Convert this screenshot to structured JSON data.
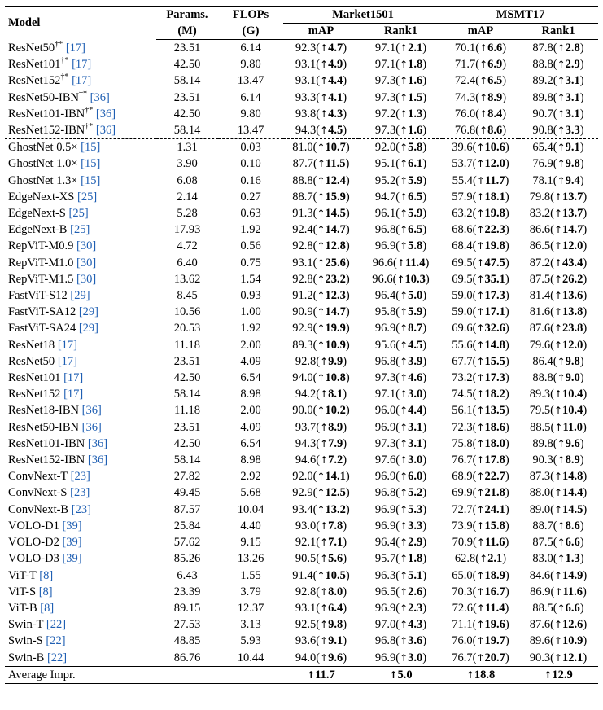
{
  "headers": {
    "model": "Model",
    "params_line1": "Params.",
    "params_line2": "(M)",
    "flops_line1": "FLOPs",
    "flops_line2": "(G)",
    "dataset1": "Market1501",
    "dataset2": "MSMT17",
    "metric_map": "mAP",
    "metric_rank1": "Rank1"
  },
  "rows": [
    {
      "name": "ResNet50",
      "mark": "†*",
      "cite": "17",
      "params": "23.51",
      "flops": "6.14",
      "m_map": "92.3",
      "m_map_d": "4.7",
      "m_r1": "97.1",
      "m_r1_d": "2.1",
      "s_map": "70.1",
      "s_map_d": "6.6",
      "s_r1": "87.8",
      "s_r1_d": "2.8"
    },
    {
      "name": "ResNet101",
      "mark": "†*",
      "cite": "17",
      "params": "42.50",
      "flops": "9.80",
      "m_map": "93.1",
      "m_map_d": "4.9",
      "m_r1": "97.1",
      "m_r1_d": "1.8",
      "s_map": "71.7",
      "s_map_d": "6.9",
      "s_r1": "88.8",
      "s_r1_d": "2.9"
    },
    {
      "name": "ResNet152",
      "mark": "†*",
      "cite": "17",
      "params": "58.14",
      "flops": "13.47",
      "m_map": "93.1",
      "m_map_d": "4.4",
      "m_r1": "97.3",
      "m_r1_d": "1.6",
      "s_map": "72.4",
      "s_map_d": "6.5",
      "s_r1": "89.2",
      "s_r1_d": "3.1"
    },
    {
      "name": "ResNet50-IBN",
      "mark": "†*",
      "cite": "36",
      "params": "23.51",
      "flops": "6.14",
      "m_map": "93.3",
      "m_map_d": "4.1",
      "m_r1": "97.3",
      "m_r1_d": "1.5",
      "s_map": "74.3",
      "s_map_d": "8.9",
      "s_r1": "89.8",
      "s_r1_d": "3.1"
    },
    {
      "name": "ResNet101-IBN",
      "mark": "†*",
      "cite": "36",
      "params": "42.50",
      "flops": "9.80",
      "m_map": "93.8",
      "m_map_d": "4.3",
      "m_r1": "97.2",
      "m_r1_d": "1.3",
      "s_map": "76.0",
      "s_map_d": "8.4",
      "s_r1": "90.7",
      "s_r1_d": "3.1"
    },
    {
      "name": "ResNet152-IBN",
      "mark": "†*",
      "cite": "36",
      "params": "58.14",
      "flops": "13.47",
      "m_map": "94.3",
      "m_map_d": "4.5",
      "m_r1": "97.3",
      "m_r1_d": "1.6",
      "s_map": "76.8",
      "s_map_d": "8.6",
      "s_r1": "90.8",
      "s_r1_d": "3.3"
    },
    {
      "name": "GhostNet 0.5×",
      "mark": "",
      "cite": "15",
      "params": "1.31",
      "flops": "0.03",
      "m_map": "81.0",
      "m_map_d": "10.7",
      "m_r1": "92.0",
      "m_r1_d": "5.8",
      "s_map": "39.6",
      "s_map_d": "10.6",
      "s_r1": "65.4",
      "s_r1_d": "9.1"
    },
    {
      "name": "GhostNet 1.0×",
      "mark": "",
      "cite": "15",
      "params": "3.90",
      "flops": "0.10",
      "m_map": "87.7",
      "m_map_d": "11.5",
      "m_r1": "95.1",
      "m_r1_d": "6.1",
      "s_map": "53.7",
      "s_map_d": "12.0",
      "s_r1": "76.9",
      "s_r1_d": "9.8"
    },
    {
      "name": "GhostNet 1.3×",
      "mark": "",
      "cite": "15",
      "params": "6.08",
      "flops": "0.16",
      "m_map": "88.8",
      "m_map_d": "12.4",
      "m_r1": "95.2",
      "m_r1_d": "5.9",
      "s_map": "55.4",
      "s_map_d": "11.7",
      "s_r1": "78.1",
      "s_r1_d": "9.4"
    },
    {
      "name": "EdgeNext-XS",
      "mark": "",
      "cite": "25",
      "params": "2.14",
      "flops": "0.27",
      "m_map": "88.7",
      "m_map_d": "15.9",
      "m_r1": "94.7",
      "m_r1_d": "6.5",
      "s_map": "57.9",
      "s_map_d": "18.1",
      "s_r1": "79.8",
      "s_r1_d": "13.7"
    },
    {
      "name": "EdgeNext-S",
      "mark": "",
      "cite": "25",
      "params": "5.28",
      "flops": "0.63",
      "m_map": "91.3",
      "m_map_d": "14.5",
      "m_r1": "96.1",
      "m_r1_d": "5.9",
      "s_map": "63.2",
      "s_map_d": "19.8",
      "s_r1": "83.2",
      "s_r1_d": "13.7"
    },
    {
      "name": "EdgeNext-B",
      "mark": "",
      "cite": "25",
      "params": "17.93",
      "flops": "1.92",
      "m_map": "92.4",
      "m_map_d": "14.7",
      "m_r1": "96.8",
      "m_r1_d": "6.5",
      "s_map": "68.6",
      "s_map_d": "22.3",
      "s_r1": "86.6",
      "s_r1_d": "14.7"
    },
    {
      "name": "RepViT-M0.9",
      "mark": "",
      "cite": "30",
      "params": "4.72",
      "flops": "0.56",
      "m_map": "92.8",
      "m_map_d": "12.8",
      "m_r1": "96.9",
      "m_r1_d": "5.8",
      "s_map": "68.4",
      "s_map_d": "19.8",
      "s_r1": "86.5",
      "s_r1_d": "12.0"
    },
    {
      "name": "RepViT-M1.0",
      "mark": "",
      "cite": "30",
      "params": "6.40",
      "flops": "0.75",
      "m_map": "93.1",
      "m_map_d": "25.6",
      "m_r1": "96.6",
      "m_r1_d": "11.4",
      "s_map": "69.5",
      "s_map_d": "47.5",
      "s_r1": "87.2",
      "s_r1_d": "43.4"
    },
    {
      "name": "RepViT-M1.5",
      "mark": "",
      "cite": "30",
      "params": "13.62",
      "flops": "1.54",
      "m_map": "92.8",
      "m_map_d": "23.2",
      "m_r1": "96.6",
      "m_r1_d": "10.3",
      "s_map": "69.5",
      "s_map_d": "35.1",
      "s_r1": "87.5",
      "s_r1_d": "26.2"
    },
    {
      "name": "FastViT-S12",
      "mark": "",
      "cite": "29",
      "params": "8.45",
      "flops": "0.93",
      "m_map": "91.2",
      "m_map_d": "12.3",
      "m_r1": "96.4",
      "m_r1_d": "5.0",
      "s_map": "59.0",
      "s_map_d": "17.3",
      "s_r1": "81.4",
      "s_r1_d": "13.6"
    },
    {
      "name": "FastViT-SA12",
      "mark": "",
      "cite": "29",
      "params": "10.56",
      "flops": "1.00",
      "m_map": "90.9",
      "m_map_d": "14.7",
      "m_r1": "95.8",
      "m_r1_d": "5.9",
      "s_map": "59.0",
      "s_map_d": "17.1",
      "s_r1": "81.6",
      "s_r1_d": "13.8"
    },
    {
      "name": "FastViT-SA24",
      "mark": "",
      "cite": "29",
      "params": "20.53",
      "flops": "1.92",
      "m_map": "92.9",
      "m_map_d": "19.9",
      "m_r1": "96.9",
      "m_r1_d": "8.7",
      "s_map": "69.6",
      "s_map_d": "32.6",
      "s_r1": "87.6",
      "s_r1_d": "23.8"
    },
    {
      "name": "ResNet18",
      "mark": "",
      "cite": "17",
      "params": "11.18",
      "flops": "2.00",
      "m_map": "89.3",
      "m_map_d": "10.9",
      "m_r1": "95.6",
      "m_r1_d": "4.5",
      "s_map": "55.6",
      "s_map_d": "14.8",
      "s_r1": "79.6",
      "s_r1_d": "12.0"
    },
    {
      "name": "ResNet50",
      "mark": "",
      "cite": "17",
      "params": "23.51",
      "flops": "4.09",
      "m_map": "92.8",
      "m_map_d": "9.9",
      "m_r1": "96.8",
      "m_r1_d": "3.9",
      "s_map": "67.7",
      "s_map_d": "15.5",
      "s_r1": "86.4",
      "s_r1_d": "9.8"
    },
    {
      "name": "ResNet101",
      "mark": "",
      "cite": "17",
      "params": "42.50",
      "flops": "6.54",
      "m_map": "94.0",
      "m_map_d": "10.8",
      "m_r1": "97.3",
      "m_r1_d": "4.6",
      "s_map": "73.2",
      "s_map_d": "17.3",
      "s_r1": "88.8",
      "s_r1_d": "9.0"
    },
    {
      "name": "ResNet152",
      "mark": "",
      "cite": "17",
      "params": "58.14",
      "flops": "8.98",
      "m_map": "94.2",
      "m_map_d": "8.1",
      "m_r1": "97.1",
      "m_r1_d": "3.0",
      "s_map": "74.5",
      "s_map_d": "18.2",
      "s_r1": "89.3",
      "s_r1_d": "10.4"
    },
    {
      "name": "ResNet18-IBN",
      "mark": "",
      "cite": "36",
      "params": "11.18",
      "flops": "2.00",
      "m_map": "90.0",
      "m_map_d": "10.2",
      "m_r1": "96.0",
      "m_r1_d": "4.4",
      "s_map": "56.1",
      "s_map_d": "13.5",
      "s_r1": "79.5",
      "s_r1_d": "10.4"
    },
    {
      "name": "ResNet50-IBN",
      "mark": "",
      "cite": "36",
      "params": "23.51",
      "flops": "4.09",
      "m_map": "93.7",
      "m_map_d": "8.9",
      "m_r1": "96.9",
      "m_r1_d": "3.1",
      "s_map": "72.3",
      "s_map_d": "18.6",
      "s_r1": "88.5",
      "s_r1_d": "11.0"
    },
    {
      "name": "ResNet101-IBN",
      "mark": "",
      "cite": "36",
      "params": "42.50",
      "flops": "6.54",
      "m_map": "94.3",
      "m_map_d": "7.9",
      "m_r1": "97.3",
      "m_r1_d": "3.1",
      "s_map": "75.8",
      "s_map_d": "18.0",
      "s_r1": "89.8",
      "s_r1_d": "9.6"
    },
    {
      "name": "ResNet152-IBN",
      "mark": "",
      "cite": "36",
      "params": "58.14",
      "flops": "8.98",
      "m_map": "94.6",
      "m_map_d": "7.2",
      "m_r1": "97.6",
      "m_r1_d": "3.0",
      "s_map": "76.7",
      "s_map_d": "17.8",
      "s_r1": "90.3",
      "s_r1_d": "8.9"
    },
    {
      "name": "ConvNext-T",
      "mark": "",
      "cite": "23",
      "params": "27.82",
      "flops": "2.92",
      "m_map": "92.0",
      "m_map_d": "14.1",
      "m_r1": "96.9",
      "m_r1_d": "6.0",
      "s_map": "68.9",
      "s_map_d": "22.7",
      "s_r1": "87.3",
      "s_r1_d": "14.8"
    },
    {
      "name": "ConvNext-S",
      "mark": "",
      "cite": "23",
      "params": "49.45",
      "flops": "5.68",
      "m_map": "92.9",
      "m_map_d": "12.5",
      "m_r1": "96.8",
      "m_r1_d": "5.2",
      "s_map": "69.9",
      "s_map_d": "21.8",
      "s_r1": "88.0",
      "s_r1_d": "14.4"
    },
    {
      "name": "ConvNext-B",
      "mark": "",
      "cite": "23",
      "params": "87.57",
      "flops": "10.04",
      "m_map": "93.4",
      "m_map_d": "13.2",
      "m_r1": "96.9",
      "m_r1_d": "5.3",
      "s_map": "72.7",
      "s_map_d": "24.1",
      "s_r1": "89.0",
      "s_r1_d": "14.5"
    },
    {
      "name": "VOLO-D1",
      "mark": "",
      "cite": "39",
      "params": "25.84",
      "flops": "4.40",
      "m_map": "93.0",
      "m_map_d": "7.8",
      "m_r1": "96.9",
      "m_r1_d": "3.3",
      "s_map": "73.9",
      "s_map_d": "15.8",
      "s_r1": "88.7",
      "s_r1_d": "8.6"
    },
    {
      "name": "VOLO-D2",
      "mark": "",
      "cite": "39",
      "params": "57.62",
      "flops": "9.15",
      "m_map": "92.1",
      "m_map_d": "7.1",
      "m_r1": "96.4",
      "m_r1_d": "2.9",
      "s_map": "70.9",
      "s_map_d": "11.6",
      "s_r1": "87.5",
      "s_r1_d": "6.6"
    },
    {
      "name": "VOLO-D3",
      "mark": "",
      "cite": "39",
      "params": "85.26",
      "flops": "13.26",
      "m_map": "90.5",
      "m_map_d": "5.6",
      "m_r1": "95.7",
      "m_r1_d": "1.8",
      "s_map": "62.8",
      "s_map_d": "2.1",
      "s_r1": "83.0",
      "s_r1_d": "1.3"
    },
    {
      "name": "ViT-T",
      "mark": "",
      "cite": "8",
      "params": "6.43",
      "flops": "1.55",
      "m_map": "91.4",
      "m_map_d": "10.5",
      "m_r1": "96.3",
      "m_r1_d": "5.1",
      "s_map": "65.0",
      "s_map_d": "18.9",
      "s_r1": "84.6",
      "s_r1_d": "14.9"
    },
    {
      "name": "ViT-S",
      "mark": "",
      "cite": "8",
      "params": "23.39",
      "flops": "3.79",
      "m_map": "92.8",
      "m_map_d": "8.0",
      "m_r1": "96.5",
      "m_r1_d": "2.6",
      "s_map": "70.3",
      "s_map_d": "16.7",
      "s_r1": "86.9",
      "s_r1_d": "11.6"
    },
    {
      "name": "ViT-B",
      "mark": "",
      "cite": "8",
      "params": "89.15",
      "flops": "12.37",
      "m_map": "93.1",
      "m_map_d": "6.4",
      "m_r1": "96.9",
      "m_r1_d": "2.3",
      "s_map": "72.6",
      "s_map_d": "11.4",
      "s_r1": "88.5",
      "s_r1_d": "6.6"
    },
    {
      "name": "Swin-T",
      "mark": "",
      "cite": "22",
      "params": "27.53",
      "flops": "3.13",
      "m_map": "92.5",
      "m_map_d": "9.8",
      "m_r1": "97.0",
      "m_r1_d": "4.3",
      "s_map": "71.1",
      "s_map_d": "19.6",
      "s_r1": "87.6",
      "s_r1_d": "12.6"
    },
    {
      "name": "Swin-S",
      "mark": "",
      "cite": "22",
      "params": "48.85",
      "flops": "5.93",
      "m_map": "93.6",
      "m_map_d": "9.1",
      "m_r1": "96.8",
      "m_r1_d": "3.6",
      "s_map": "76.0",
      "s_map_d": "19.7",
      "s_r1": "89.6",
      "s_r1_d": "10.9"
    },
    {
      "name": "Swin-B",
      "mark": "",
      "cite": "22",
      "params": "86.76",
      "flops": "10.44",
      "m_map": "94.0",
      "m_map_d": "9.6",
      "m_r1": "96.9",
      "m_r1_d": "3.0",
      "s_map": "76.7",
      "s_map_d": "20.7",
      "s_r1": "90.3",
      "s_r1_d": "12.1"
    }
  ],
  "average": {
    "label": "Average Impr.",
    "m_map": "11.7",
    "m_r1": "5.0",
    "s_map": "18.8",
    "s_r1": "12.9"
  },
  "arrow_symbol": "↑"
}
